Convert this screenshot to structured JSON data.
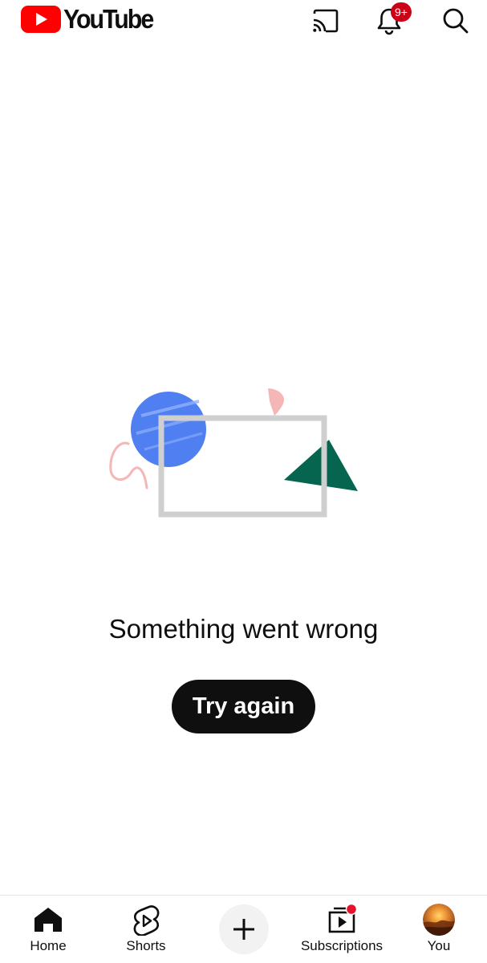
{
  "header": {
    "logo_text": "YouTube",
    "notification_count": "9+",
    "icons": [
      "youtube-logo-icon",
      "cast-icon",
      "bell-icon",
      "search-icon"
    ],
    "brand_color": "#ff0000",
    "badge_color": "#cc0017"
  },
  "error": {
    "title": "Something went wrong",
    "retry_label": "Try again"
  },
  "nav": {
    "home_label": "Home",
    "shorts_label": "Shorts",
    "create_icon": "plus-icon",
    "subscriptions_label": "Subscriptions",
    "you_label": "You",
    "subscriptions_dot_color": "#e8112d"
  }
}
